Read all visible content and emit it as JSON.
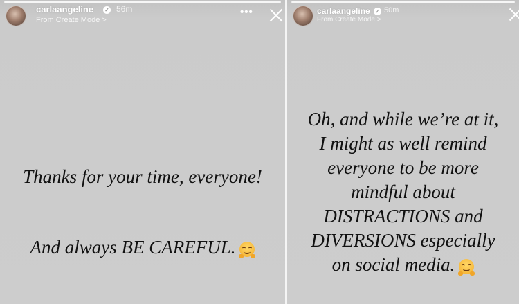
{
  "stories": [
    {
      "username": "carlaangeline",
      "time": "56m",
      "subline": "From Create Mode",
      "subline_arrow": ">",
      "more": "•••",
      "lines": [
        "Thanks for your time, everyone!",
        "And always BE CAREFUL."
      ],
      "emoji": "smiling-face-with-open-hands"
    },
    {
      "username": "carlaangeline",
      "time": "50m",
      "subline": "From Create Mode",
      "subline_arrow": ">",
      "lines": [
        "Oh, and while we’re at it,",
        "I might as well remind",
        "everyone to be more",
        "mindful about",
        "DISTRACTIONS and",
        "DIVERSIONS especially",
        "on social media."
      ],
      "emoji": "smiling-face-with-open-hands"
    }
  ],
  "verified_mark": "✓",
  "colors": {
    "background": "#cdcdcd",
    "text": "#111111",
    "header_text": "#ffffff"
  }
}
